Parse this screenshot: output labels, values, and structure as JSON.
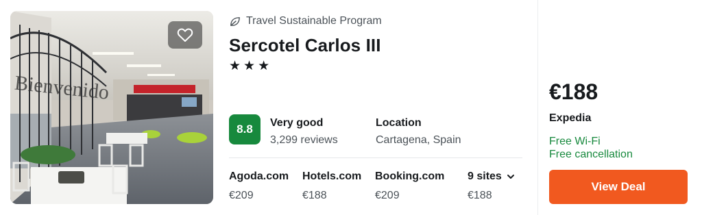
{
  "hotel": {
    "eco_badge": "Travel Sustainable Program",
    "name": "Sercotel Carlos III",
    "stars": "★★★",
    "star_count": 3,
    "score": "8.8",
    "rating_word": "Very good",
    "reviews": "3,299 reviews",
    "location_label": "Location",
    "location_value": "Cartagena, Spain",
    "photo_sign_text": "Bienvenido"
  },
  "sites": [
    {
      "name": "Agoda.com",
      "price": "€209"
    },
    {
      "name": "Hotels.com",
      "price": "€188"
    },
    {
      "name": "Booking.com",
      "price": "€209"
    },
    {
      "name": "9 sites",
      "price": "€188"
    }
  ],
  "deal": {
    "price": "€188",
    "provider": "Expedia",
    "perks": [
      "Free Wi-Fi",
      "Free cancellation"
    ],
    "button_label": "View Deal"
  },
  "colors": {
    "score_bg": "#17893d",
    "perk_text": "#17893d",
    "cta_bg": "#f1591f"
  },
  "icons": {
    "favorite": "heart-outline-icon",
    "eco": "leaf-icon",
    "more_sites": "chevron-down-icon"
  }
}
